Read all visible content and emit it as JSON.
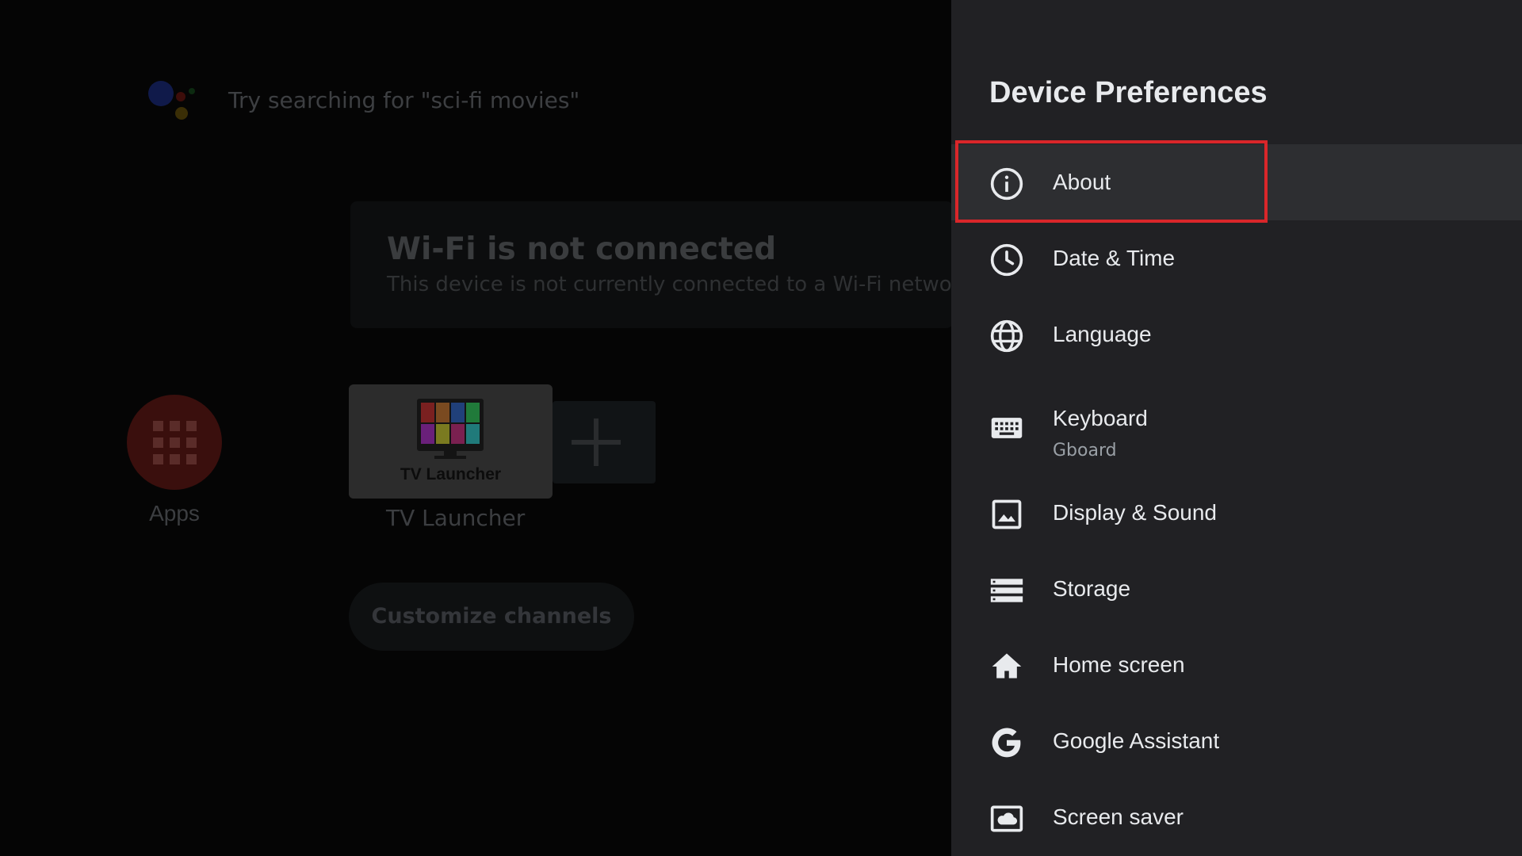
{
  "home": {
    "search_hint": "Try searching for \"sci-fi movies\"",
    "wifi_title": "Wi-Fi is not connected",
    "wifi_message": "This device is not currently connected to a Wi-Fi network",
    "apps_label": "Apps",
    "launcher_tile_text": "TV Launcher",
    "launcher_label": "TV Launcher",
    "customize_button": "Customize channels",
    "assistant_colors": [
      "#1a237e",
      "#8b1a14",
      "#8a6d0c",
      "#1b5e20"
    ]
  },
  "panel": {
    "title": "Device Preferences",
    "focus_color": "#d9262a",
    "items": [
      {
        "label": "About",
        "icon": "info-icon",
        "selected": true
      },
      {
        "label": "Date & Time",
        "icon": "clock-icon"
      },
      {
        "label": "Language",
        "icon": "globe-icon"
      },
      {
        "label": "Keyboard",
        "sublabel": "Gboard",
        "icon": "keyboard-icon"
      },
      {
        "label": "Display & Sound",
        "icon": "image-icon"
      },
      {
        "label": "Storage",
        "icon": "storage-icon"
      },
      {
        "label": "Home screen",
        "icon": "home-icon"
      },
      {
        "label": "Google Assistant",
        "icon": "google-icon"
      },
      {
        "label": "Screen saver",
        "icon": "screensaver-icon"
      }
    ]
  }
}
